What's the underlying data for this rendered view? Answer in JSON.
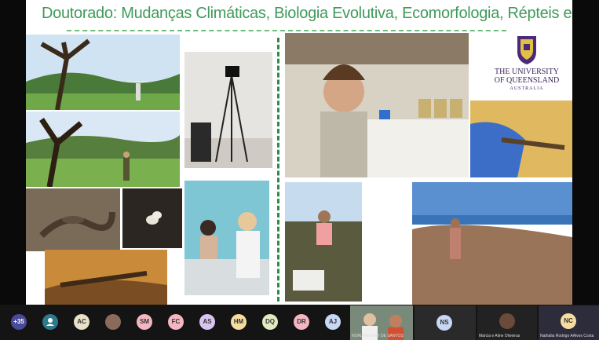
{
  "slide": {
    "title": "Doutorado: Mudanças Climáticas, Biologia Evolutiva, Ecomorfologia, Répteis e Marsupiais",
    "logo": {
      "line1": "THE UNIVERSITY",
      "line2": "OF QUEENSLAND",
      "line3": "AUSTRALIA"
    }
  },
  "toolbar": {
    "more_count": "+35",
    "participants": [
      {
        "initials": "AC",
        "color": "#e8e0c8"
      },
      {
        "initials": "SM",
        "color": "#f4b6c2"
      },
      {
        "initials": "FC",
        "color": "#f4b6c2"
      },
      {
        "initials": "AS",
        "color": "#d8c4f0"
      },
      {
        "initials": "HM",
        "color": "#f6dca0"
      },
      {
        "initials": "DQ",
        "color": "#e0ecc0"
      },
      {
        "initials": "DR",
        "color": "#f4b6c2"
      },
      {
        "initials": "AJ",
        "color": "#c8d8f4"
      },
      {
        "initials": "NS",
        "color": "#c8d8f4"
      },
      {
        "initials": "NC",
        "color": "#f6dca0"
      }
    ],
    "tiles": [
      {
        "label": "NORIANE RAFI DE SANTOS"
      },
      {
        "label": "Márcia e Aline Oliveiras"
      },
      {
        "label": "Nathália  Rodrigo AAlves Costa"
      }
    ]
  }
}
